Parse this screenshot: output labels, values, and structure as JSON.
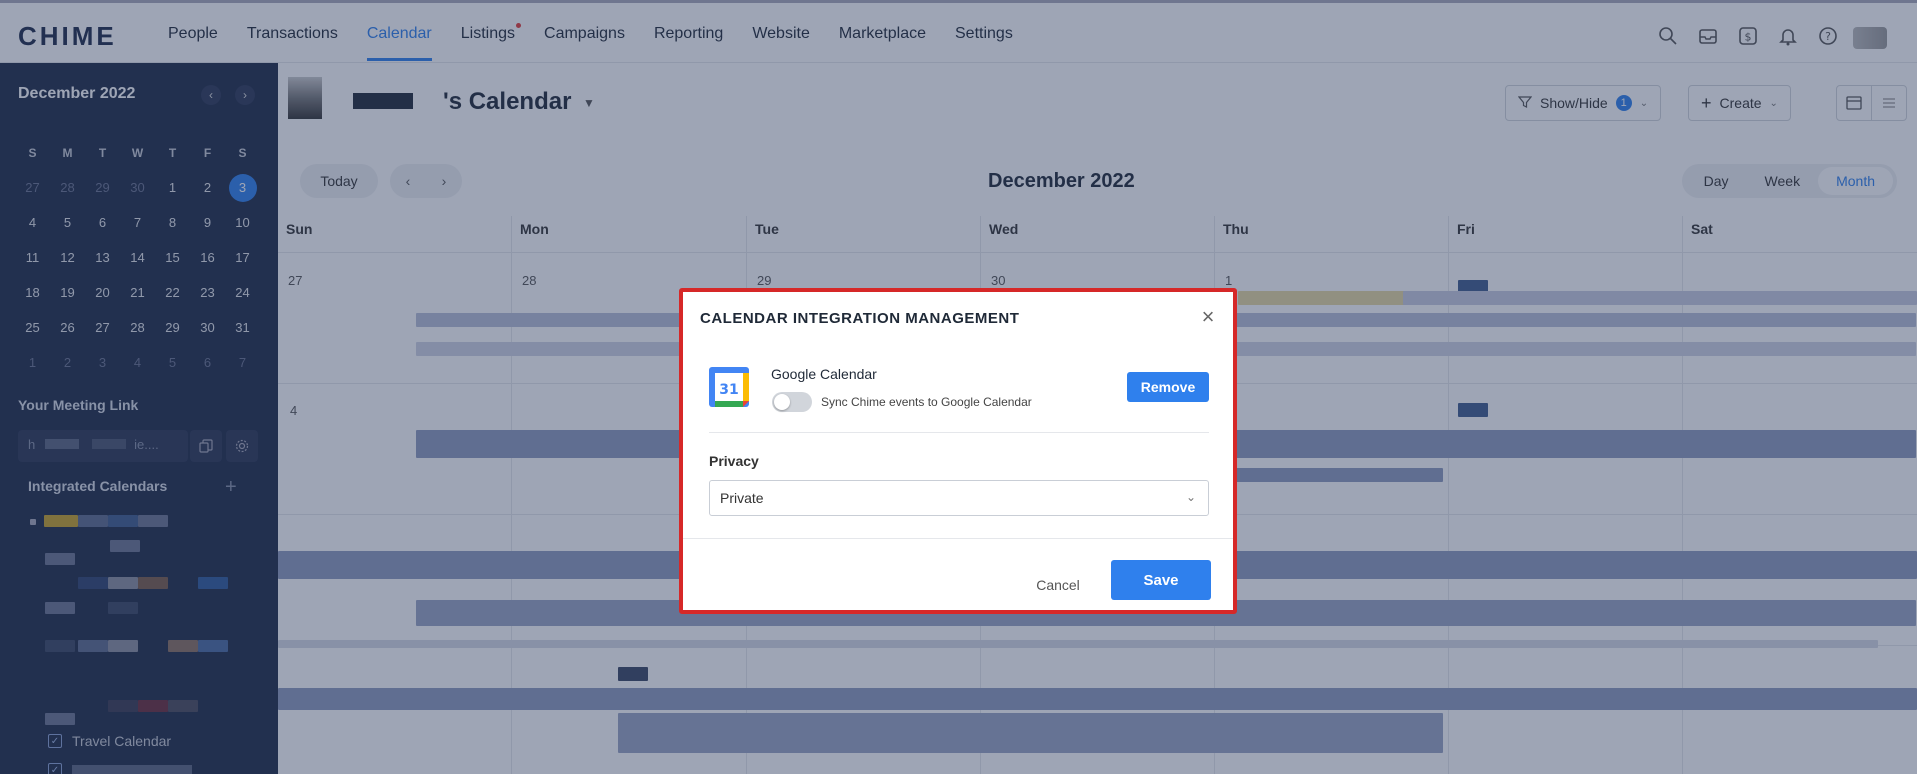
{
  "brand": {
    "logo": "CHIME"
  },
  "nav": {
    "items": [
      {
        "label": "People"
      },
      {
        "label": "Transactions"
      },
      {
        "label": "Calendar",
        "active": true
      },
      {
        "label": "Listings",
        "dot": true
      },
      {
        "label": "Campaigns"
      },
      {
        "label": "Reporting"
      },
      {
        "label": "Website"
      },
      {
        "label": "Marketplace"
      },
      {
        "label": "Settings"
      }
    ],
    "icons": [
      "search-icon",
      "inbox-icon",
      "dollar-icon",
      "bell-icon",
      "help-icon"
    ]
  },
  "sidebar": {
    "month": "December 2022",
    "weekdays": [
      "S",
      "M",
      "T",
      "W",
      "T",
      "F",
      "S"
    ],
    "weeks": [
      [
        "27",
        "28",
        "29",
        "30",
        "1",
        "2",
        "3"
      ],
      [
        "4",
        "5",
        "6",
        "7",
        "8",
        "9",
        "10"
      ],
      [
        "11",
        "12",
        "13",
        "14",
        "15",
        "16",
        "17"
      ],
      [
        "18",
        "19",
        "20",
        "21",
        "22",
        "23",
        "24"
      ],
      [
        "25",
        "26",
        "27",
        "28",
        "29",
        "30",
        "31"
      ],
      [
        "1",
        "2",
        "3",
        "4",
        "5",
        "6",
        "7"
      ]
    ],
    "today": "3",
    "meeting_link_title": "Your Meeting Link",
    "meeting_link_value": "h",
    "meeting_link_suffix": "ie....",
    "integrated_title": "Integrated Calendars",
    "calendar_items": [
      {
        "label": "Travel Calendar",
        "checked": true
      }
    ]
  },
  "header": {
    "title": "'s Calendar",
    "show_hide_label": "Show/Hide",
    "show_hide_count": "1",
    "create_label": "Create"
  },
  "toolbar": {
    "today_label": "Today",
    "month_title": "December 2022",
    "views": [
      "Day",
      "Week",
      "Month"
    ],
    "active_view": "Month"
  },
  "calendar": {
    "days": [
      "Sun",
      "Mon",
      "Tue",
      "Wed",
      "Thu",
      "Fri",
      "Sat"
    ],
    "week1_nums": [
      "27",
      "28",
      "29",
      "30",
      "1"
    ],
    "week2_nums": [
      "4"
    ]
  },
  "modal": {
    "title": "CALENDAR INTEGRATION MANAGEMENT",
    "service_name": "Google Calendar",
    "icon_text": "31",
    "sync_text": "Sync Chime events to Google Calendar",
    "sync_enabled": false,
    "remove_label": "Remove",
    "privacy_label": "Privacy",
    "privacy_value": "Private",
    "cancel_label": "Cancel",
    "save_label": "Save",
    "colors": {
      "primary": "#2f80ed",
      "highlight_border": "#d62828"
    }
  }
}
